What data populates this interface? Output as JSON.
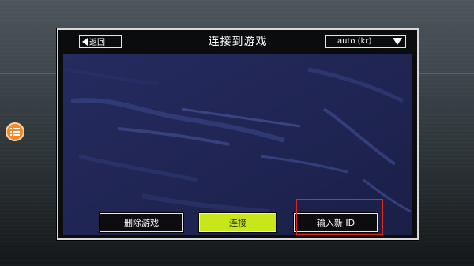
{
  "header": {
    "back_label": "返回",
    "title": "连接到游戏",
    "region_value": "auto (kr)"
  },
  "buttons": {
    "delete_label": "删除游戏",
    "connect_label": "连接",
    "new_id_label": "输入新 ID"
  },
  "colors": {
    "panel_bg": "#0b0c0e",
    "map_bg": "#1f2451",
    "connect_accent": "#c8e61a",
    "highlight": "#e0251f",
    "floating_button": "#f08a2c"
  },
  "icons": {
    "back": "back-arrow-icon",
    "dropdown": "dropdown-triangle-icon",
    "floating_menu": "menu-list-icon"
  }
}
